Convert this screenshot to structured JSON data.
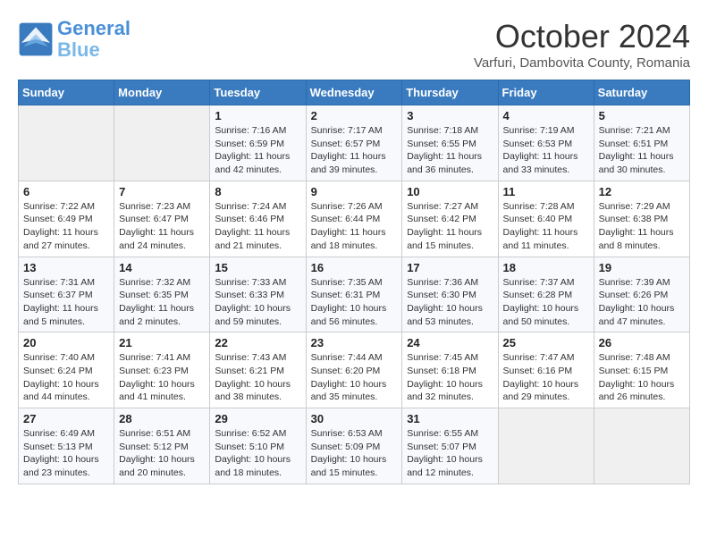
{
  "logo": {
    "line1": "General",
    "line2": "Blue"
  },
  "title": "October 2024",
  "subtitle": "Varfuri, Dambovita County, Romania",
  "days_of_week": [
    "Sunday",
    "Monday",
    "Tuesday",
    "Wednesday",
    "Thursday",
    "Friday",
    "Saturday"
  ],
  "weeks": [
    [
      {
        "day": "",
        "empty": true
      },
      {
        "day": "",
        "empty": true
      },
      {
        "day": "1",
        "sunrise": "7:16 AM",
        "sunset": "6:59 PM",
        "daylight": "11 hours and 42 minutes."
      },
      {
        "day": "2",
        "sunrise": "7:17 AM",
        "sunset": "6:57 PM",
        "daylight": "11 hours and 39 minutes."
      },
      {
        "day": "3",
        "sunrise": "7:18 AM",
        "sunset": "6:55 PM",
        "daylight": "11 hours and 36 minutes."
      },
      {
        "day": "4",
        "sunrise": "7:19 AM",
        "sunset": "6:53 PM",
        "daylight": "11 hours and 33 minutes."
      },
      {
        "day": "5",
        "sunrise": "7:21 AM",
        "sunset": "6:51 PM",
        "daylight": "11 hours and 30 minutes."
      }
    ],
    [
      {
        "day": "6",
        "sunrise": "7:22 AM",
        "sunset": "6:49 PM",
        "daylight": "11 hours and 27 minutes."
      },
      {
        "day": "7",
        "sunrise": "7:23 AM",
        "sunset": "6:47 PM",
        "daylight": "11 hours and 24 minutes."
      },
      {
        "day": "8",
        "sunrise": "7:24 AM",
        "sunset": "6:46 PM",
        "daylight": "11 hours and 21 minutes."
      },
      {
        "day": "9",
        "sunrise": "7:26 AM",
        "sunset": "6:44 PM",
        "daylight": "11 hours and 18 minutes."
      },
      {
        "day": "10",
        "sunrise": "7:27 AM",
        "sunset": "6:42 PM",
        "daylight": "11 hours and 15 minutes."
      },
      {
        "day": "11",
        "sunrise": "7:28 AM",
        "sunset": "6:40 PM",
        "daylight": "11 hours and 11 minutes."
      },
      {
        "day": "12",
        "sunrise": "7:29 AM",
        "sunset": "6:38 PM",
        "daylight": "11 hours and 8 minutes."
      }
    ],
    [
      {
        "day": "13",
        "sunrise": "7:31 AM",
        "sunset": "6:37 PM",
        "daylight": "11 hours and 5 minutes."
      },
      {
        "day": "14",
        "sunrise": "7:32 AM",
        "sunset": "6:35 PM",
        "daylight": "11 hours and 2 minutes."
      },
      {
        "day": "15",
        "sunrise": "7:33 AM",
        "sunset": "6:33 PM",
        "daylight": "10 hours and 59 minutes."
      },
      {
        "day": "16",
        "sunrise": "7:35 AM",
        "sunset": "6:31 PM",
        "daylight": "10 hours and 56 minutes."
      },
      {
        "day": "17",
        "sunrise": "7:36 AM",
        "sunset": "6:30 PM",
        "daylight": "10 hours and 53 minutes."
      },
      {
        "day": "18",
        "sunrise": "7:37 AM",
        "sunset": "6:28 PM",
        "daylight": "10 hours and 50 minutes."
      },
      {
        "day": "19",
        "sunrise": "7:39 AM",
        "sunset": "6:26 PM",
        "daylight": "10 hours and 47 minutes."
      }
    ],
    [
      {
        "day": "20",
        "sunrise": "7:40 AM",
        "sunset": "6:24 PM",
        "daylight": "10 hours and 44 minutes."
      },
      {
        "day": "21",
        "sunrise": "7:41 AM",
        "sunset": "6:23 PM",
        "daylight": "10 hours and 41 minutes."
      },
      {
        "day": "22",
        "sunrise": "7:43 AM",
        "sunset": "6:21 PM",
        "daylight": "10 hours and 38 minutes."
      },
      {
        "day": "23",
        "sunrise": "7:44 AM",
        "sunset": "6:20 PM",
        "daylight": "10 hours and 35 minutes."
      },
      {
        "day": "24",
        "sunrise": "7:45 AM",
        "sunset": "6:18 PM",
        "daylight": "10 hours and 32 minutes."
      },
      {
        "day": "25",
        "sunrise": "7:47 AM",
        "sunset": "6:16 PM",
        "daylight": "10 hours and 29 minutes."
      },
      {
        "day": "26",
        "sunrise": "7:48 AM",
        "sunset": "6:15 PM",
        "daylight": "10 hours and 26 minutes."
      }
    ],
    [
      {
        "day": "27",
        "sunrise": "6:49 AM",
        "sunset": "5:13 PM",
        "daylight": "10 hours and 23 minutes."
      },
      {
        "day": "28",
        "sunrise": "6:51 AM",
        "sunset": "5:12 PM",
        "daylight": "10 hours and 20 minutes."
      },
      {
        "day": "29",
        "sunrise": "6:52 AM",
        "sunset": "5:10 PM",
        "daylight": "10 hours and 18 minutes."
      },
      {
        "day": "30",
        "sunrise": "6:53 AM",
        "sunset": "5:09 PM",
        "daylight": "10 hours and 15 minutes."
      },
      {
        "day": "31",
        "sunrise": "6:55 AM",
        "sunset": "5:07 PM",
        "daylight": "10 hours and 12 minutes."
      },
      {
        "day": "",
        "empty": true
      },
      {
        "day": "",
        "empty": true
      }
    ]
  ]
}
